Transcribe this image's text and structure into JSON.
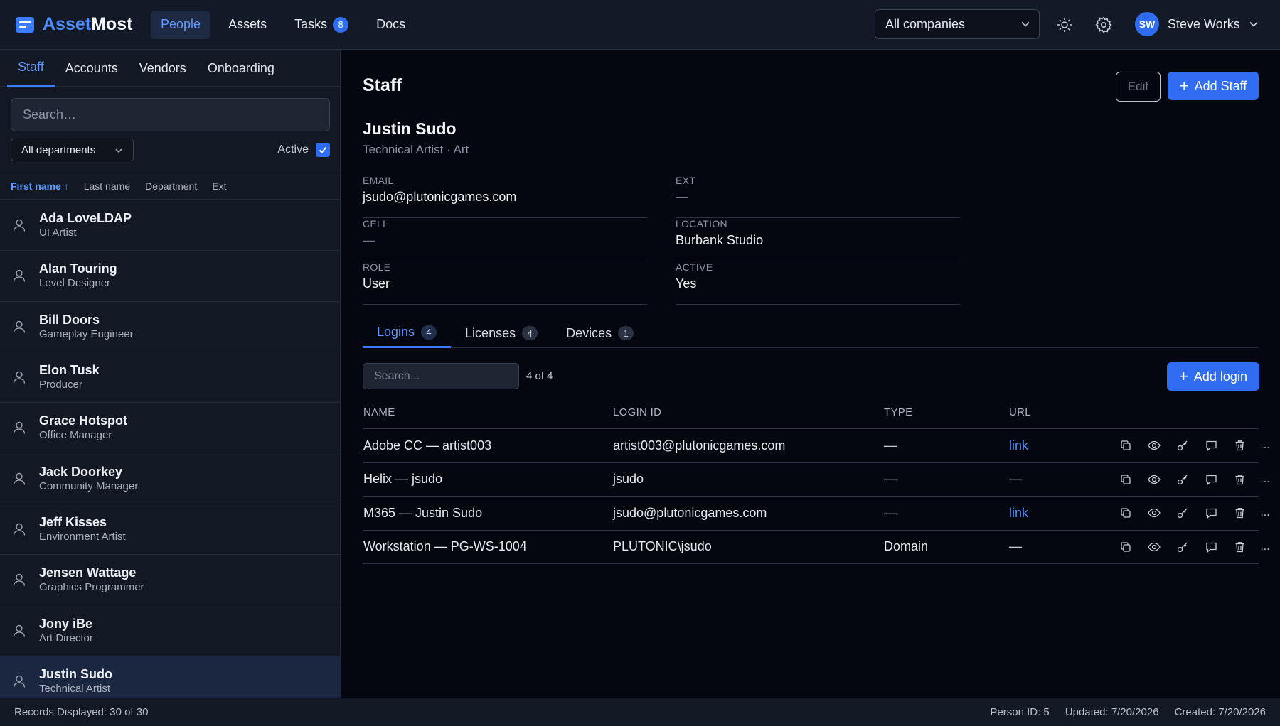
{
  "app": {
    "name_a": "Asset",
    "name_b": "Most"
  },
  "topnav": [
    {
      "label": "People",
      "active": true
    },
    {
      "label": "Assets"
    },
    {
      "label": "Tasks",
      "badge": "8"
    },
    {
      "label": "Docs"
    }
  ],
  "company_select": {
    "value": "All companies"
  },
  "user": {
    "initials": "SW",
    "name": "Steve Works"
  },
  "sidebar": {
    "tabs": [
      {
        "label": "Staff",
        "active": true
      },
      {
        "label": "Accounts"
      },
      {
        "label": "Vendors"
      },
      {
        "label": "Onboarding"
      }
    ],
    "search_placeholder": "Search…",
    "department_filter": "All departments",
    "active_label": "Active",
    "active_checked": true,
    "columns": [
      "First name ↑",
      "Last name",
      "Department",
      "Ext"
    ],
    "people": [
      {
        "name": "Ada LoveLDAP",
        "role": "UI Artist"
      },
      {
        "name": "Alan Touring",
        "role": "Level Designer"
      },
      {
        "name": "Bill Doors",
        "role": "Gameplay Engineer"
      },
      {
        "name": "Elon Tusk",
        "role": "Producer"
      },
      {
        "name": "Grace Hotspot",
        "role": "Office Manager"
      },
      {
        "name": "Jack Doorkey",
        "role": "Community Manager"
      },
      {
        "name": "Jeff Kisses",
        "role": "Environment Artist"
      },
      {
        "name": "Jensen Wattage",
        "role": "Graphics Programmer"
      },
      {
        "name": "Jony iBe",
        "role": "Art Director"
      },
      {
        "name": "Justin Sudo",
        "role": "Technical Artist",
        "selected": true
      }
    ]
  },
  "footer": {
    "records": "Records Displayed: 30 of 30",
    "person_id": "Person ID: 5",
    "updated": "Updated: 7/20/2026",
    "created": "Created: 7/20/2026"
  },
  "main": {
    "title": "Staff",
    "edit_label": "Edit",
    "add_staff_label": "Add Staff",
    "person": {
      "name": "Justin Sudo",
      "subtitle": "Technical Artist · Art"
    },
    "fields": {
      "email_label": "EMAIL",
      "email": "jsudo@plutonicgames.com",
      "ext_label": "EXT",
      "ext": "—",
      "cell_label": "CELL",
      "cell": "—",
      "location_label": "LOCATION",
      "location": "Burbank Studio",
      "role_label": "ROLE",
      "role": "User",
      "active_label": "ACTIVE",
      "active": "Yes"
    },
    "tabs": [
      {
        "label": "Logins",
        "count": "4",
        "active": true
      },
      {
        "label": "Licenses",
        "count": "4"
      },
      {
        "label": "Devices",
        "count": "1"
      }
    ],
    "login_search_placeholder": "Search...",
    "login_count": "4 of 4",
    "add_login_label": "Add login",
    "table": {
      "headers": [
        "NAME",
        "LOGIN ID",
        "TYPE",
        "URL"
      ],
      "rows": [
        {
          "name": "Adobe CC — artist003",
          "login_id": "artist003@plutonicgames.com",
          "type": "—",
          "url": "link"
        },
        {
          "name": "Helix — jsudo",
          "login_id": "jsudo",
          "type": "—",
          "url": "—"
        },
        {
          "name": "M365 — Justin Sudo",
          "login_id": "jsudo@plutonicgames.com",
          "type": "—",
          "url": "link"
        },
        {
          "name": "Workstation — PG-WS-1004",
          "login_id": "PLUTONIC\\jsudo",
          "type": "Domain",
          "url": "—"
        }
      ],
      "more_label": "..."
    }
  },
  "colors": {
    "accent": "#2f6cf0",
    "link": "#4d8dff",
    "background": "#04070f",
    "panel": "#121925"
  }
}
